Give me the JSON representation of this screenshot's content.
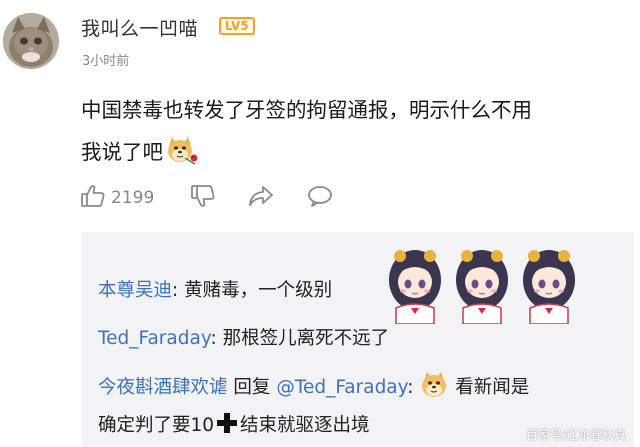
{
  "comment": {
    "user": {
      "name": "我叫么一凹喵",
      "level_badge": "LV5"
    },
    "time": "3小时前",
    "text_line1": "中国禁毒也转发了牙签的拘留通报，明示什么不用",
    "text_line2": "我说了吧",
    "actions": {
      "like_count": "2199"
    }
  },
  "replies": [
    {
      "user": "本尊吴迪",
      "text": "黄赌毒，一个级别"
    },
    {
      "user": "Ted_Faraday",
      "text": "那根签儿离死不远了"
    },
    {
      "user": "今夜斟酒肆欢谑",
      "reply_word": "回复",
      "target": "@Ted_Faraday",
      "text_after_emoji": "看新闻是",
      "text_line2_a": "确定判了要10",
      "text_line2_b": "结束就驱逐出境"
    }
  ],
  "watermark": "百家号/辽东春秋真",
  "colors": {
    "username_link": "#3b73b9",
    "level_badge": "#f3a12c",
    "reply_bg": "#f3f3f6"
  }
}
